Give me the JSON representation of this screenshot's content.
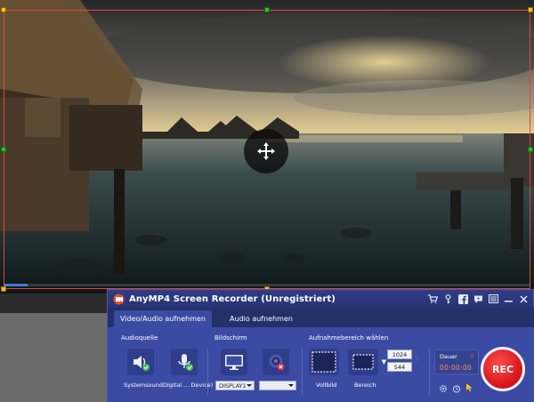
{
  "app": {
    "title": "AnyMP4 Screen Recorder (Unregistriert)"
  },
  "tabs": [
    {
      "label": "Video/Audio aufnehmen",
      "active": true
    },
    {
      "label": "Audio aufnehmen",
      "active": false
    }
  ],
  "sections": {
    "audio": "Audioquelle",
    "screen": "Bildschirm",
    "area": "Aufnahmebereich wählen"
  },
  "audio": {
    "system_label": "Systemsound",
    "mic_label": "Digital ... Device)"
  },
  "screen": {
    "display_selected": "DISPLAY1",
    "second_selected": ""
  },
  "area": {
    "fullscreen_label": "Vollbild",
    "region_label": "Bereich",
    "width": "1024",
    "height": "544"
  },
  "duration": {
    "label": "Dauer",
    "value": "00:00:00"
  },
  "record": {
    "label": "REC"
  },
  "progress": {
    "fraction": 0.045
  },
  "colors": {
    "frame": "#e0463a",
    "accent": "#3b4ba3",
    "rec": "#d3141b"
  }
}
